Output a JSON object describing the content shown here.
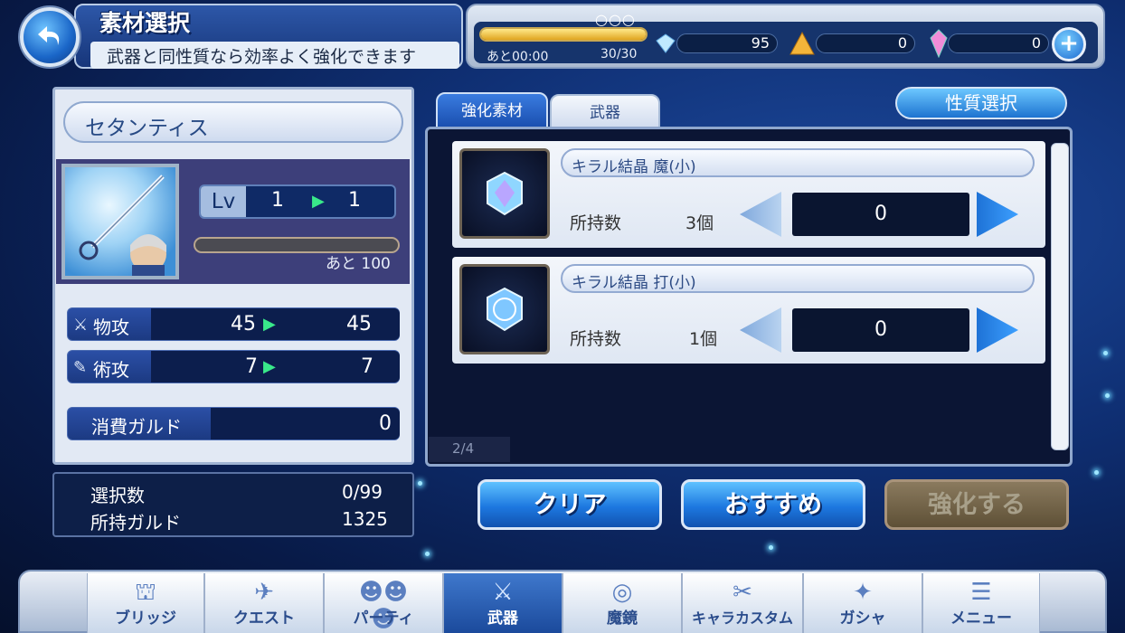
{
  "header": {
    "title": "素材選択",
    "subtitle": "武器と同性質なら効率よく強化できます"
  },
  "resources": {
    "dots": "○○○",
    "stamina_timer": "あと00:00",
    "stamina": "30/30",
    "gems": "95",
    "crystal_shards": "0",
    "prisms": "0"
  },
  "weapon": {
    "name": "セタンティス",
    "lv_label": "Lv",
    "lv_from": "1",
    "lv_to": "1",
    "exp_remaining": "あと 100",
    "stats": [
      {
        "label": "物攻",
        "from": "45",
        "to": "45"
      },
      {
        "label": "術攻",
        "from": "7",
        "to": "7"
      }
    ],
    "gil_cost_label": "消費ガルド",
    "gil_cost": "0"
  },
  "summary": {
    "selected_label": "選択数",
    "selected": "0/99",
    "owned_gil_label": "所持ガルド",
    "owned_gil": "1325"
  },
  "tabs": [
    {
      "label": "強化素材"
    },
    {
      "label": "武器"
    }
  ],
  "trait_button": "性質選択",
  "materials": [
    {
      "name": "キラル結晶 魔(小)",
      "owned_label": "所持数",
      "owned": "3個",
      "qty": "0"
    },
    {
      "name": "キラル結晶 打(小)",
      "owned_label": "所持数",
      "owned": "1個",
      "qty": "0"
    }
  ],
  "page_indicator": "2/4",
  "actions": {
    "clear": "クリア",
    "recommend": "おすすめ",
    "enhance": "強化する"
  },
  "nav": [
    {
      "label": "ブリッジ",
      "icon": "bridge-icon"
    },
    {
      "label": "クエスト",
      "icon": "quest-icon"
    },
    {
      "label": "パーティ",
      "icon": "party-icon"
    },
    {
      "label": "武器",
      "icon": "weapon-icon"
    },
    {
      "label": "魔鏡",
      "icon": "mirror-icon"
    },
    {
      "label": "キャラカスタム",
      "icon": "character-custom-icon"
    },
    {
      "label": "ガシャ",
      "icon": "gacha-icon"
    },
    {
      "label": "メニュー",
      "icon": "menu-icon"
    }
  ]
}
